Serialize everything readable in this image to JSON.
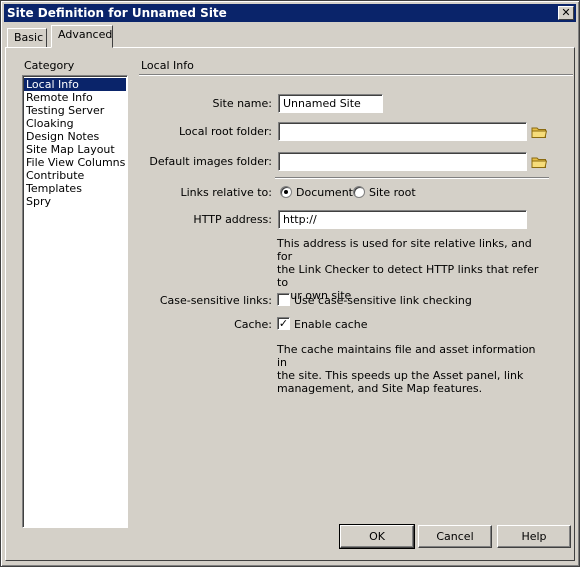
{
  "window": {
    "title": "Site Definition for Unnamed Site",
    "close_label": "✕"
  },
  "tabs": [
    {
      "label": "Basic"
    },
    {
      "label": "Advanced"
    }
  ],
  "category": {
    "heading": "Category",
    "items": [
      {
        "label": "Local Info"
      },
      {
        "label": "Remote Info"
      },
      {
        "label": "Testing Server"
      },
      {
        "label": "Cloaking"
      },
      {
        "label": "Design Notes"
      },
      {
        "label": "Site Map Layout"
      },
      {
        "label": "File View Columns"
      },
      {
        "label": "Contribute"
      },
      {
        "label": "Templates"
      },
      {
        "label": "Spry"
      }
    ],
    "selected": "Local Info"
  },
  "panel": {
    "title": "Local Info",
    "site_name": {
      "label": "Site name:",
      "value": "Unnamed Site"
    },
    "local_root": {
      "label": "Local root folder:",
      "value": "",
      "icon": "folder-icon"
    },
    "default_images": {
      "label": "Default images folder:",
      "value": "",
      "icon": "folder-icon"
    },
    "links_relative": {
      "label": "Links relative to:",
      "options": [
        {
          "label": "Document",
          "selected": true
        },
        {
          "label": "Site root",
          "selected": false
        }
      ]
    },
    "http_address": {
      "label": "HTTP address:",
      "value": "http://",
      "note_lines": [
        "This address is used for site relative links, and for",
        "the Link Checker to detect HTTP links that refer to",
        "your own site"
      ]
    },
    "case_sensitive": {
      "label": "Case-sensitive links:",
      "checkbox_label": "Use case-sensitive link checking",
      "checked": false
    },
    "cache": {
      "label": "Cache:",
      "checkbox_label": "Enable cache",
      "checked": true,
      "check_mark": "✓",
      "note_lines": [
        "The cache maintains file and asset information in",
        "the site.  This speeds up the Asset panel, link",
        "management, and Site Map features."
      ]
    }
  },
  "buttons": {
    "ok": "OK",
    "cancel": "Cancel",
    "help": "Help"
  },
  "colors": {
    "titlebar": "#0a246a",
    "face": "#d4d0c8",
    "selection": "#0a246a",
    "folder": "#e8c048"
  }
}
